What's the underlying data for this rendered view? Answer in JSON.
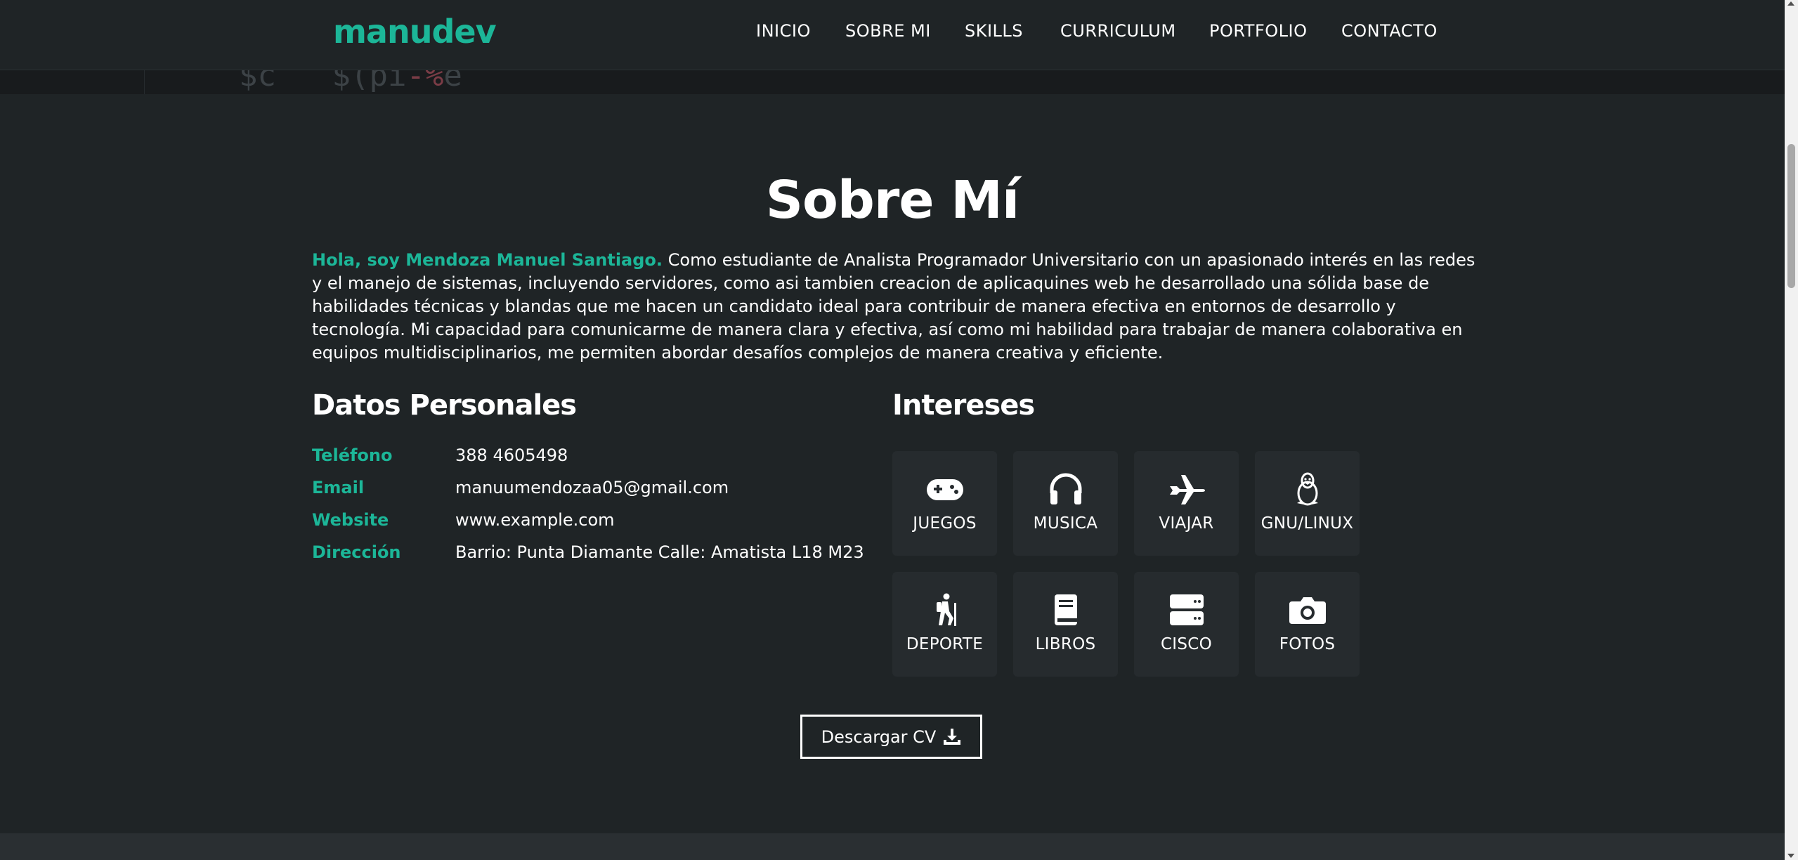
{
  "header": {
    "logo": "manudev",
    "nav": [
      "INICIO",
      "SOBRE MI",
      "SKILLS",
      "CURRICULUM",
      "PORTFOLIO",
      "CONTACTO"
    ]
  },
  "hero_remnant": {
    "text_left": "$c",
    "text_mid": "$(pi",
    "text_red": "-%",
    "text_end": "e"
  },
  "about": {
    "title": "Sobre Mí",
    "intro_highlight": "Hola, soy Mendoza Manuel Santiago.",
    "intro_text": " Como estudiante de Analista Programador Universitario con un apasionado interés en las redes y el manejo de sistemas, incluyendo servidores, como asi tambien creacion de aplicaquines web he desarrollado una sólida base de habilidades técnicas y blandas que me hacen un candidato ideal para contribuir de manera efectiva en entornos de desarrollo y tecnología. Mi capacidad para comunicarme de manera clara y efectiva, así como mi habilidad para trabajar de manera colaborativa en equipos multidisciplinarios, me permiten abordar desafíos complejos de manera creativa y eficiente."
  },
  "datos": {
    "title": "Datos Personales",
    "rows": [
      {
        "key": "Teléfono",
        "value": "388 4605498"
      },
      {
        "key": "Email",
        "value": "manuumendozaa05@gmail.com"
      },
      {
        "key": "Website",
        "value": "www.example.com"
      },
      {
        "key": "Dirección",
        "value": "Barrio: Punta Diamante Calle: Amatista L18 M23"
      }
    ]
  },
  "intereses": {
    "title": "Intereses",
    "items": [
      {
        "label": "JUEGOS",
        "icon": "gamepad-icon"
      },
      {
        "label": "MUSICA",
        "icon": "headphones-icon"
      },
      {
        "label": "VIAJAR",
        "icon": "plane-icon"
      },
      {
        "label": "GNU/LINUX",
        "icon": "linux-icon"
      },
      {
        "label": "DEPORTE",
        "icon": "hiking-icon"
      },
      {
        "label": "LIBROS",
        "icon": "book-icon"
      },
      {
        "label": "CISCO",
        "icon": "server-icon"
      },
      {
        "label": "FOTOS",
        "icon": "camera-icon"
      }
    ]
  },
  "cv_button": {
    "label": "Descargar CV",
    "icon": "download-icon"
  },
  "colors": {
    "accent": "#1cb698",
    "background": "#1f2426",
    "tile": "#262b2e"
  }
}
